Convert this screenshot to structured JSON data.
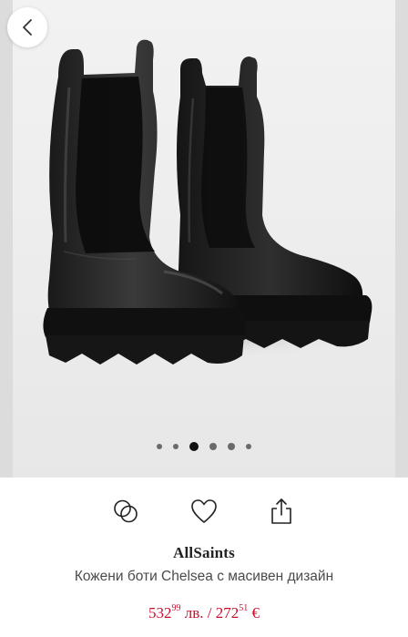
{
  "gallery": {
    "image_alt": "Black leather Chelsea boots with chunky platform soles",
    "dots": [
      {
        "size": "s",
        "active": false
      },
      {
        "size": "s",
        "active": false
      },
      {
        "size": "l",
        "active": true
      },
      {
        "size": "m",
        "active": false
      },
      {
        "size": "m",
        "active": false
      },
      {
        "size": "s",
        "active": false
      }
    ]
  },
  "navigation": {
    "back_icon": "chevron-left-icon"
  },
  "actions": {
    "compare_icon": "compare-circles-icon",
    "wishlist_icon": "heart-icon",
    "share_icon": "share-icon"
  },
  "product": {
    "brand": "AllSaints",
    "name": "Кожени боти Chelsea с масивен дизайн",
    "price_bgn_main": "532",
    "price_bgn_decimal": "99",
    "price_bgn_currency": " лв. / ",
    "price_eur_main": "272",
    "price_eur_decimal": "51",
    "price_eur_currency": " €"
  },
  "colors": {
    "price": "#c8102e",
    "background": "#ffffff",
    "image_bg": "#ececec"
  }
}
